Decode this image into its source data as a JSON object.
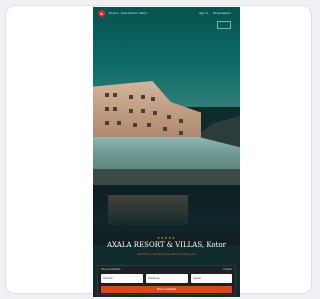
{
  "nav": {
    "logo": "A",
    "links": [
      "Rooms",
      "Experiences",
      "Offers"
    ],
    "right_links": [
      "Sign in",
      "Reservations"
    ]
  },
  "hero": {
    "stars": "★★★★★",
    "title": "AXALA RESORT & VILLAS, Kotor",
    "subtitle": "Beachfront resort with private villas and infinity pools"
  },
  "booking": {
    "title": "Check availability",
    "toggle": "Flexible",
    "fields": [
      "Check-in",
      "Check-out",
      "Guests"
    ],
    "button": "Check availability"
  }
}
